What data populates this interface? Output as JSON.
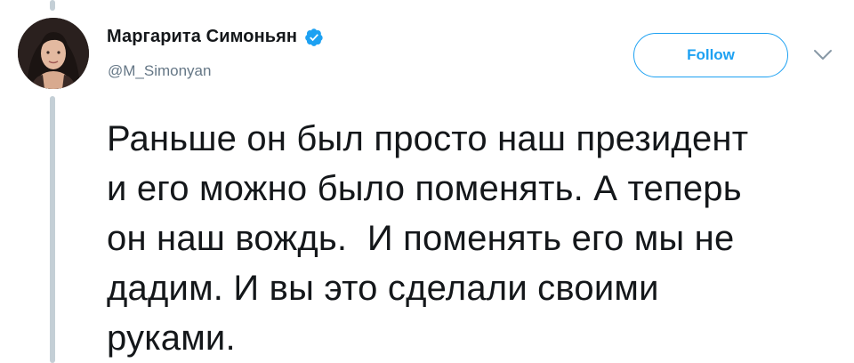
{
  "author": {
    "display_name": "Маргарита Симоньян",
    "handle": "@M_Simonyan",
    "verified": true,
    "avatar_icon": "profile-photo"
  },
  "actions": {
    "follow_label": "Follow",
    "menu_icon": "chevron-down-icon"
  },
  "tweet": {
    "text": "Раньше он был просто наш президент\nи его можно было поменять. А теперь\nон наш вождь.  И поменять его мы не\nдадим. И вы это сделали своими\nруками."
  },
  "colors": {
    "accent": "#1da1f2",
    "text_primary": "#14171a",
    "text_secondary": "#657786",
    "thread_line": "#c4cfd6"
  }
}
